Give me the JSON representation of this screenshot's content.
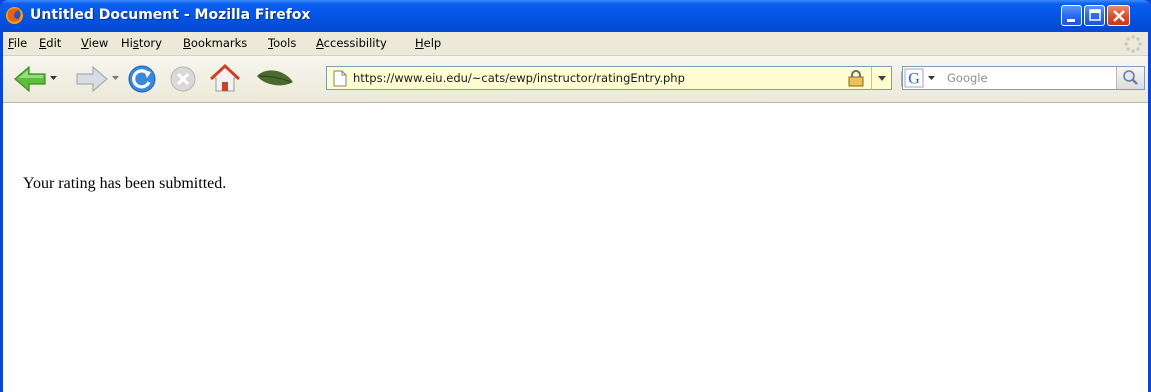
{
  "window": {
    "title": "Untitled Document - Mozilla Firefox",
    "accent_color": "#0a47d8"
  },
  "menu": {
    "items": [
      {
        "label": "File",
        "accesskey": "F"
      },
      {
        "label": "Edit",
        "accesskey": "E"
      },
      {
        "label": "View",
        "accesskey": "V"
      },
      {
        "label": "History",
        "accesskey": "s"
      },
      {
        "label": "Bookmarks",
        "accesskey": "B"
      },
      {
        "label": "Tools",
        "accesskey": "T"
      },
      {
        "label": "Accessibility",
        "accesskey": "A"
      },
      {
        "label": "Help",
        "accesskey": "H"
      }
    ]
  },
  "toolbar": {
    "icons": [
      "back-arrow-icon",
      "forward-arrow-icon",
      "reload-icon",
      "stop-icon",
      "home-icon",
      "leaf-icon"
    ],
    "url": "https://www.eiu.edu/~cats/ewp/instructor/ratingEntry.php",
    "url_bar_color": "#fffed3",
    "search_placeholder": "Google"
  },
  "content": {
    "message": "Your rating has been submitted."
  }
}
